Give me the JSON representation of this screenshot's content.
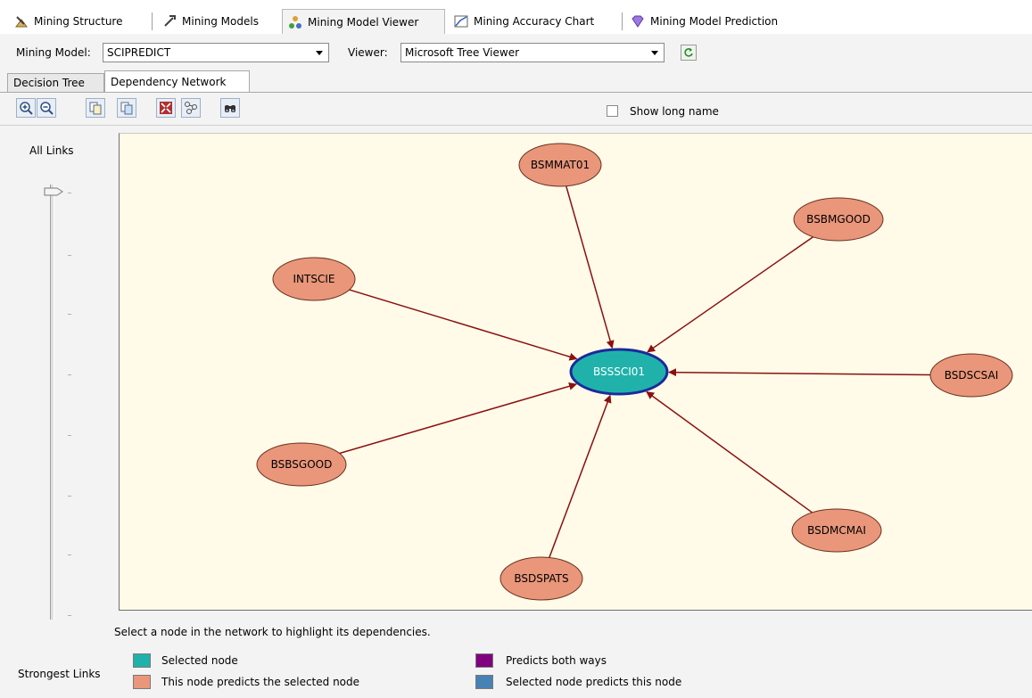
{
  "designer_tabs": [
    {
      "label": "Mining Structure",
      "icon": "mining-structure-icon"
    },
    {
      "label": "Mining Models",
      "icon": "mining-models-icon"
    },
    {
      "label": "Mining Model Viewer",
      "icon": "model-viewer-icon",
      "active": true
    },
    {
      "label": "Mining Accuracy Chart",
      "icon": "accuracy-chart-icon"
    },
    {
      "label": "Mining Model Prediction",
      "icon": "prediction-icon"
    }
  ],
  "model_row": {
    "model_label": "Mining Model:",
    "model_value": "SCIPREDICT",
    "viewer_label": "Viewer:",
    "viewer_value": "Microsoft Tree Viewer"
  },
  "sub_tabs": [
    {
      "label": "Decision Tree"
    },
    {
      "label": "Dependency Network",
      "active": true
    }
  ],
  "toolbar": {
    "buttons": [
      "zoom-in-icon",
      "zoom-out-icon",
      "copy-icon",
      "copy-graph-icon",
      "fit-to-window-icon",
      "reset-layout-icon",
      "find-node-icon"
    ],
    "show_long_name_label": "Show long name",
    "show_long_name_checked": false
  },
  "slider": {
    "top_label": "All Links",
    "bottom_label": "Strongest Links",
    "position": 0
  },
  "network": {
    "selected": "BSSSCI01",
    "nodes": [
      "BSSSCI01",
      "BSMMAT01",
      "BSBMGOOD",
      "INTSCIE",
      "BSDSCSAI",
      "BSBSGOOD",
      "BSDMCMAI",
      "BSDSPATS"
    ],
    "edges": [
      {
        "from": "BSMMAT01",
        "to": "BSSSCI01"
      },
      {
        "from": "BSBMGOOD",
        "to": "BSSSCI01"
      },
      {
        "from": "INTSCIE",
        "to": "BSSSCI01"
      },
      {
        "from": "BSDSCSAI",
        "to": "BSSSCI01"
      },
      {
        "from": "BSBSGOOD",
        "to": "BSSSCI01"
      },
      {
        "from": "BSDMCMAI",
        "to": "BSSSCI01"
      },
      {
        "from": "BSDSPATS",
        "to": "BSSSCI01"
      }
    ],
    "colors": {
      "selected_fill": "#20b2aa",
      "selected_border": "#1c2a9c",
      "predictor_fill": "#e9967a",
      "edge": "#8b1010",
      "canvas_bg": "#fffbe8"
    }
  },
  "hint_text": "Select a node in the network to highlight its dependencies.",
  "legend": [
    {
      "label": "Selected node",
      "color": "#20b2aa"
    },
    {
      "label": "This node predicts the selected node",
      "color": "#e9967a"
    },
    {
      "label": "Predicts both ways",
      "color": "#800080"
    },
    {
      "label": "Selected node predicts this node",
      "color": "#4682b4"
    }
  ]
}
